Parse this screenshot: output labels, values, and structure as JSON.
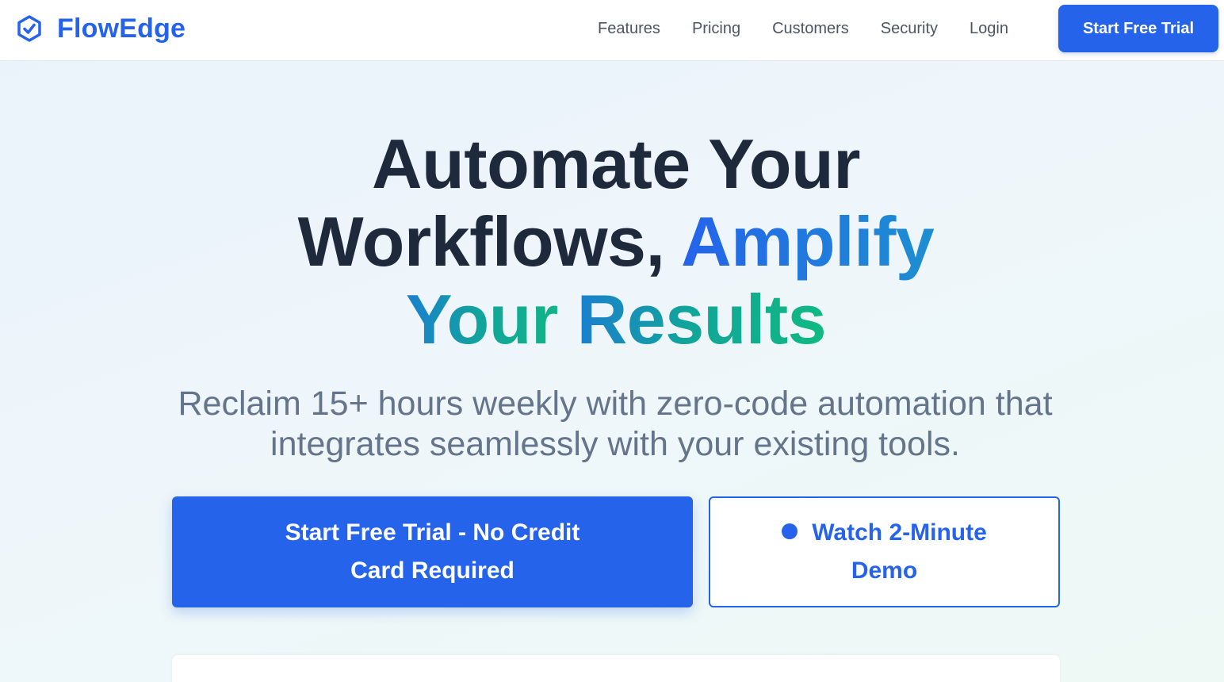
{
  "brand": {
    "name": "FlowEdge",
    "icon": "hexagon-check-icon",
    "color": "#2563eb"
  },
  "nav": {
    "links": [
      "Features",
      "Pricing",
      "Customers",
      "Security",
      "Login"
    ],
    "cta_label": "Start Free Trial"
  },
  "hero": {
    "title_part1": "Automate Your Workflows, ",
    "title_highlight1": "Amplify",
    "title_highlight2_a": "Your ",
    "title_highlight2_b": "Results",
    "subtitle": "Reclaim 15+ hours weekly with zero-code automation that integrates seamlessly with your existing tools.",
    "primary_cta": "Start Free Trial - No Credit Card Required",
    "secondary_cta": "Watch 2-Minute Demo",
    "secondary_icon": "play-dot-icon"
  },
  "colors": {
    "accent": "#2563eb",
    "teal": "#10b981",
    "heading": "#1e293b",
    "muted": "#64748b"
  }
}
